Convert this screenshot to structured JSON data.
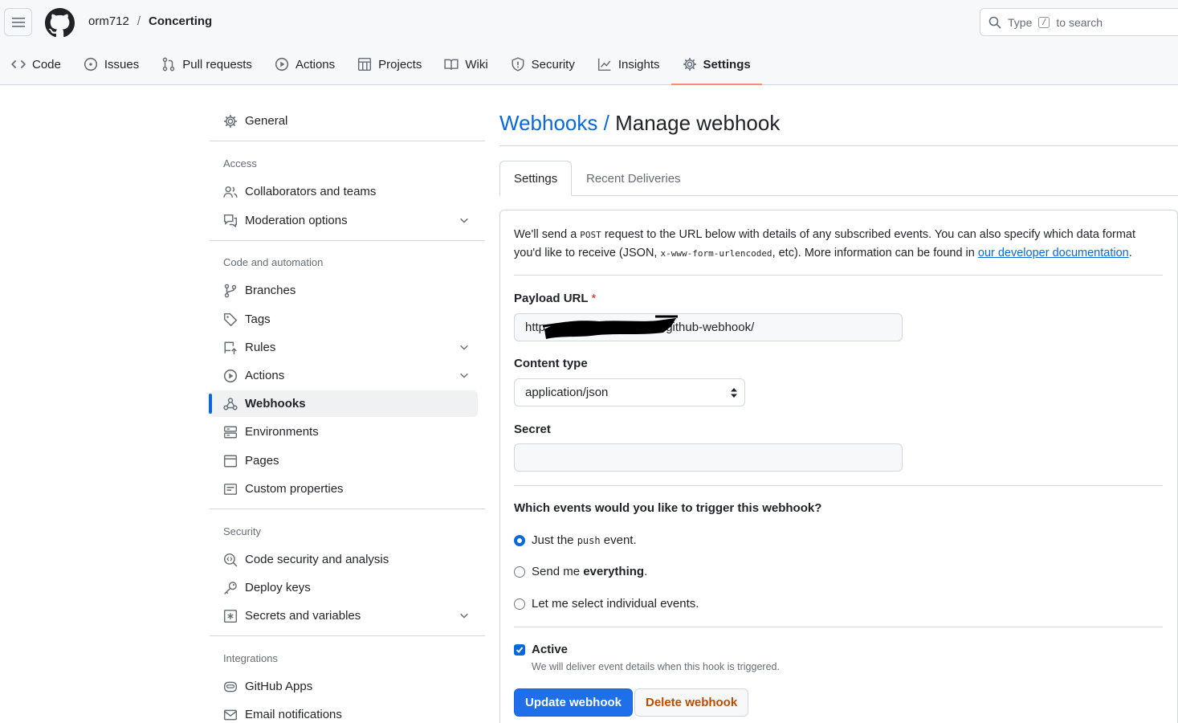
{
  "header": {
    "owner": "orm712",
    "separator": "/",
    "repo": "Concerting",
    "search": {
      "before": "Type",
      "key": "/",
      "after": "to search"
    }
  },
  "repo_nav": [
    {
      "label": "Code",
      "icon": "code-icon"
    },
    {
      "label": "Issues",
      "icon": "issue-icon"
    },
    {
      "label": "Pull requests",
      "icon": "pull-request-icon"
    },
    {
      "label": "Actions",
      "icon": "play-icon"
    },
    {
      "label": "Projects",
      "icon": "table-icon"
    },
    {
      "label": "Wiki",
      "icon": "book-icon"
    },
    {
      "label": "Security",
      "icon": "shield-icon"
    },
    {
      "label": "Insights",
      "icon": "graph-icon"
    },
    {
      "label": "Settings",
      "icon": "gear-icon",
      "active": true
    }
  ],
  "sidebar": {
    "general": "General",
    "access_heading": "Access",
    "access": [
      "Collaborators and teams",
      "Moderation options"
    ],
    "code_heading": "Code and automation",
    "code": [
      "Branches",
      "Tags",
      "Rules",
      "Actions",
      "Webhooks",
      "Environments",
      "Pages",
      "Custom properties"
    ],
    "security_heading": "Security",
    "security": [
      "Code security and analysis",
      "Deploy keys",
      "Secrets and variables"
    ],
    "integrations_heading": "Integrations",
    "integrations": [
      "GitHub Apps",
      "Email notifications"
    ],
    "active_item": "Webhooks"
  },
  "main": {
    "title_link": "Webhooks",
    "title_sep": "/",
    "title_rest": "Manage webhook",
    "tabs": [
      "Settings",
      "Recent Deliveries"
    ],
    "intro": {
      "p1": "We'll send a",
      "code1": "POST",
      "p2": "request to the URL below with details of any subscribed events. You can also specify which data format you'd like to receive (JSON,",
      "code2": "x-www-form-urlencoded",
      "p3": ", etc). More information can be found in",
      "link": "our developer documentation",
      "p4": "."
    },
    "payload_label": "Payload URL",
    "required_mark": "*",
    "payload_value_start": "http",
    "payload_value_end": "/github-webhook/",
    "content_type_label": "Content type",
    "content_type_value": "application/json",
    "secret_label": "Secret",
    "secret_value": "",
    "events_question": "Which events would you like to trigger this webhook?",
    "event_options": {
      "push": {
        "before": "Just the",
        "code": "push",
        "after": "event."
      },
      "everything": {
        "before": "Send me",
        "bold": "everything",
        "after": "."
      },
      "individual": "Let me select individual events."
    },
    "selected_event": "push",
    "active_label": "Active",
    "active_checked": true,
    "active_desc": "We will deliver event details when this hook is triggered.",
    "update_button": "Update webhook",
    "delete_button": "Delete webhook"
  },
  "colors": {
    "accent": "#0969da",
    "primary_button": "#1f6feb",
    "danger_text": "#bc4c00",
    "tab_underline": "#fd8c73"
  }
}
